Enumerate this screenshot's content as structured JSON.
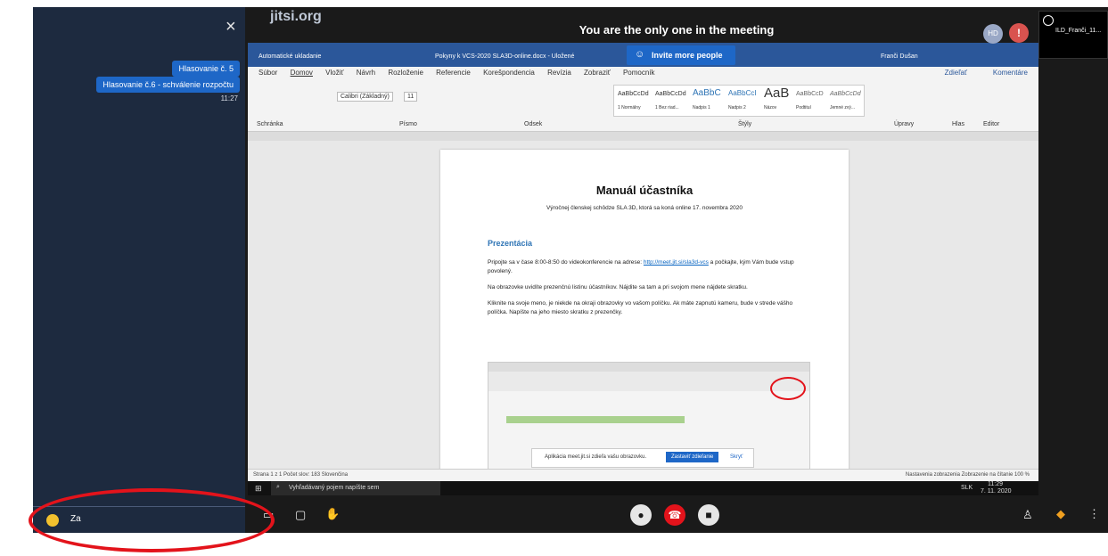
{
  "meeting": {
    "title": "You are the only one in the meeting",
    "invite_label": "Invite more people",
    "logo": "jitsi.org",
    "avatar_initials": "HD",
    "warning_symbol": "!",
    "participant_name": "ILD_Franči_11..."
  },
  "chat": {
    "close_icon": "×",
    "messages": [
      {
        "text": "Hlasovanie č. 5"
      },
      {
        "text": "Hlasovanie č.6 - schválenie rozpočtu"
      }
    ],
    "time": "11:27",
    "input_value": "Za"
  },
  "word": {
    "title_left": "Automatické ukladanie",
    "doc_name": "Pokyny k VCS-2020 SLA3D-online.docx - Uložené",
    "user": "Franči Dušan",
    "menu": [
      "Súbor",
      "Domov",
      "Vložiť",
      "Návrh",
      "Rozloženie",
      "Referencie",
      "Korešpondencia",
      "Revízia",
      "Zobraziť",
      "Pomocník"
    ],
    "share_label": "Zdieľať",
    "comments_label": "Komentáre",
    "font_name": "Calibri (Základný)",
    "font_size": "11",
    "styles": [
      "AaBbCcDd",
      "AaBbCcDd",
      "AaBbC",
      "AaBbCcI",
      "AaB",
      "AaBbCcD",
      "AaBbCcDd"
    ],
    "style_names": [
      "1 Normálny",
      "1 Bez riad...",
      "Nadpis 1",
      "Nadpis 2",
      "Názov",
      "Podtitul",
      "Jemné zvý..."
    ],
    "ribbon_groups": [
      "Schránka",
      "Písmo",
      "Odsek",
      "Štýly",
      "Úpravy",
      "Hlas",
      "Editor"
    ],
    "doc": {
      "title": "Manuál účastníka",
      "subtitle": "Výročnej členskej schôdze SLA 3D, ktorá sa koná online 17. novembra 2020",
      "heading": "Prezentácia",
      "p1_a": "Pripojte sa v čase 8:00-8:50 do videokonferencie na adrese: ",
      "p1_link": "http://meet.jit.si/sla3d-vcs",
      "p1_b": " a počkajte, kým Vám bude vstup povolený.",
      "p2": "Na obrazovke uvidíte prezenčnú listinu účastníkov. Nájdite sa tam a pri svojom mene nájdete skratku.",
      "p3": "Kliknite na svoje meno, je niekde na okraji obrazovky vo vašom políčku. Ak máte zapnutú kameru, bude v strede vášho políčka. Napíšte na jeho miesto skratku z prezenčky."
    },
    "status_left": "Strana 1 z 1   Počet slov: 183   Slovenčina",
    "status_right": "Nastavenia zobrazenia   Zobrazenie na čítanie   100 %",
    "taskbar_search": "Vyhľadávaný pojem napíšte sem",
    "taskbar_time": "11:29",
    "taskbar_date": "7. 11. 2020",
    "taskbar_lang": "SLK",
    "share_notice": "Aplikácia meet.jit.si zdieľa vašu obrazovku.",
    "stop_share": "Zastaviť zdieľanie",
    "hide": "Skryť"
  },
  "colors": {
    "chat_bg": "#1d2a3f",
    "accent": "#1e67c7",
    "hangup": "#e3131b",
    "annotation": "#e3131b"
  }
}
